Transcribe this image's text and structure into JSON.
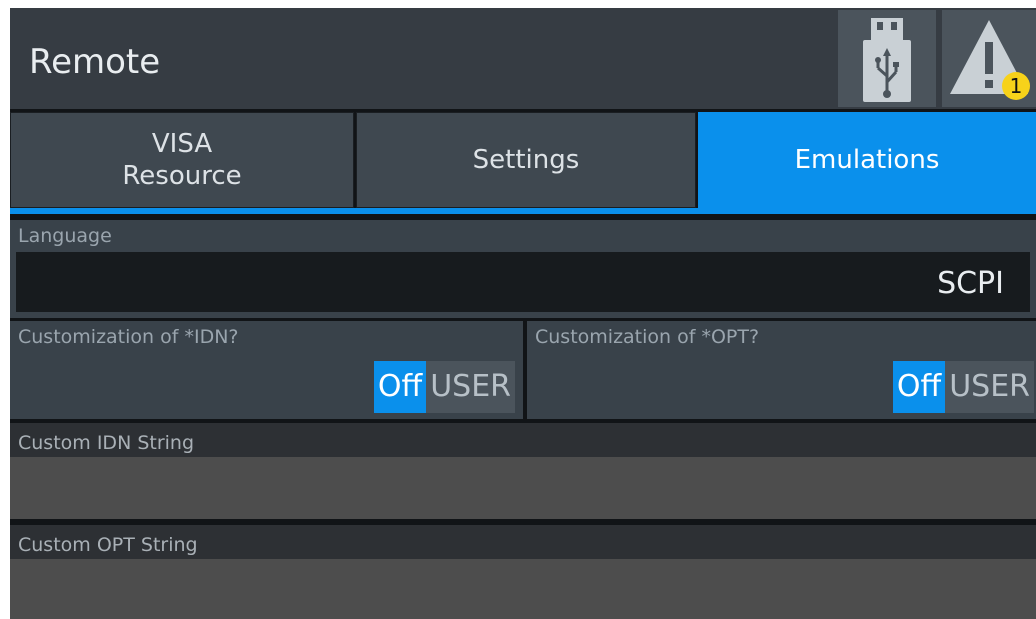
{
  "window": {
    "title": "Remote"
  },
  "status": {
    "usb_icon": "usb-icon",
    "warning_icon": "warning-icon",
    "warning_count": "1",
    "badge_color": "#f7d21a"
  },
  "tabs": [
    {
      "label": "VISA\nResource",
      "active": false
    },
    {
      "label": "Settings",
      "active": false
    },
    {
      "label": "Emulations",
      "active": true
    }
  ],
  "accent_color": "#0a90ec",
  "language": {
    "label": "Language",
    "value": "SCPI"
  },
  "idn_customization": {
    "label": "Customization of *IDN?",
    "options": [
      "Off",
      "USER"
    ],
    "selected": "Off"
  },
  "opt_customization": {
    "label": "Customization of *OPT?",
    "options": [
      "Off",
      "USER"
    ],
    "selected": "Off"
  },
  "custom_idn": {
    "label": "Custom IDN String",
    "value": ""
  },
  "custom_opt": {
    "label": "Custom OPT String",
    "value": ""
  }
}
